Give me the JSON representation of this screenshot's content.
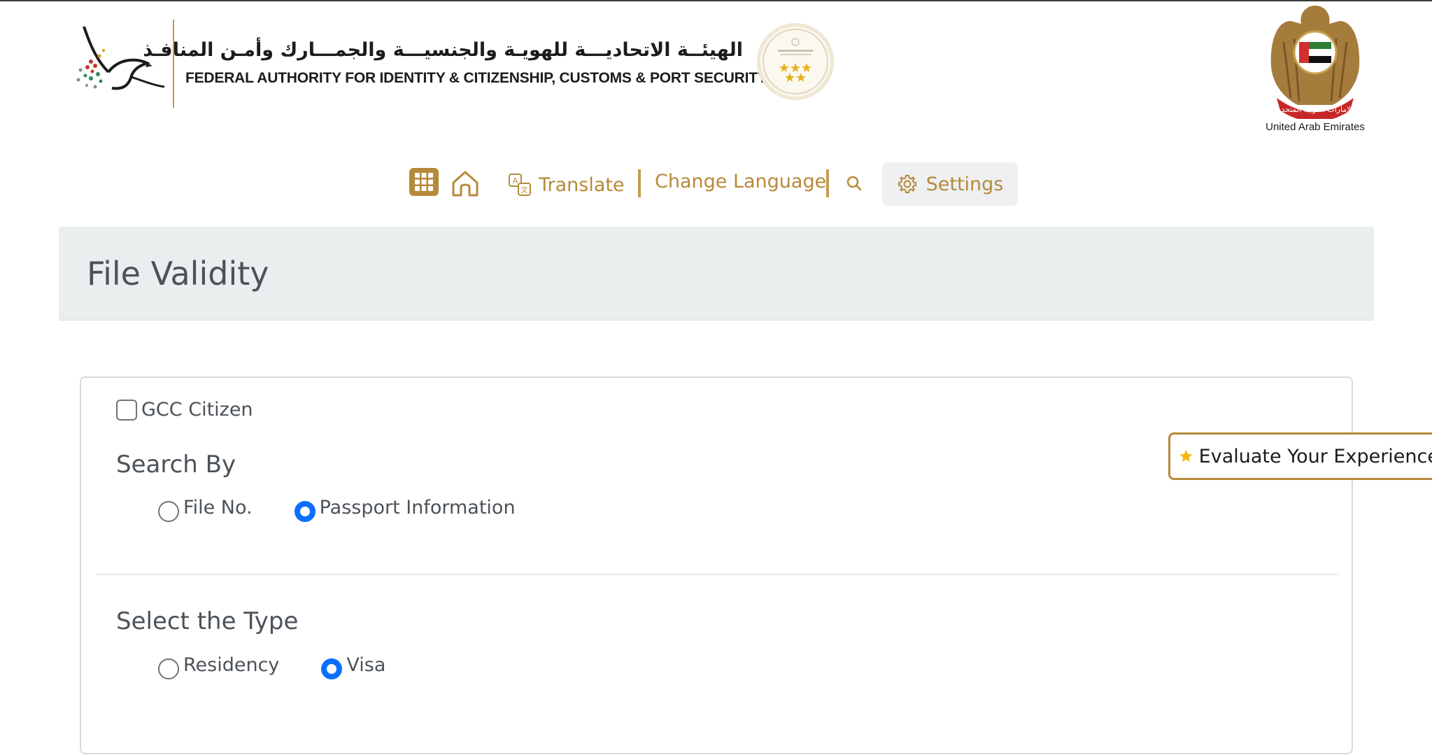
{
  "header": {
    "authority_name_ar": "الهيئــة الاتحاديـــة للهويـة والجنسيـــة والجمـــارك وأمـن المنافـذ",
    "authority_name_en": "FEDERAL AUTHORITY FOR IDENTITY & CITIZENSHIP, CUSTOMS & PORT SECURITY",
    "country_caption": "United Arab Emirates",
    "brand_color": "#b68a3a"
  },
  "nav": {
    "apps_icon": "grid-icon",
    "home_icon": "home-icon",
    "translate_label": "Translate",
    "change_language_label": "Change Language",
    "search_icon": "search-icon",
    "settings_label": "Settings"
  },
  "page": {
    "title": "File Validity"
  },
  "form": {
    "gcc_label": "GCC Citizen",
    "gcc_checked": false,
    "search_by_title": "Search By",
    "search_by_options": [
      {
        "label": "File No.",
        "checked": false
      },
      {
        "label": "Passport Information",
        "checked": true
      }
    ],
    "type_title": "Select the Type",
    "type_options": [
      {
        "label": "Residency",
        "checked": false
      },
      {
        "label": "Visa",
        "checked": true
      }
    ],
    "radio_checked_color": "#0d6efd"
  },
  "feedback": {
    "label": "Evaluate Your Experience",
    "star_color": "#f5b50a"
  }
}
